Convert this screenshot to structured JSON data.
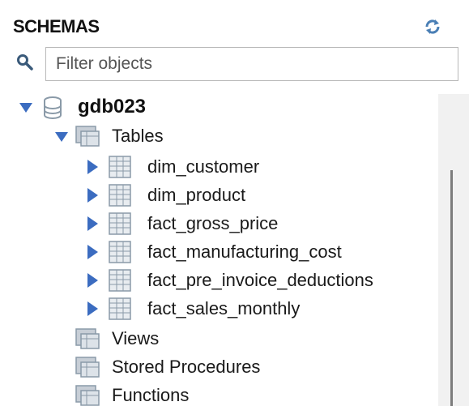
{
  "header": {
    "title": "SCHEMAS"
  },
  "icons": {
    "refresh": "refresh-icon",
    "search": "search-icon"
  },
  "filter": {
    "placeholder": "Filter objects",
    "value": ""
  },
  "tree": {
    "schema": {
      "name": "gdb023",
      "expanded": true
    },
    "tables_folder": {
      "label": "Tables",
      "expanded": true
    },
    "tables": [
      "dim_customer",
      "dim_product",
      "fact_gross_price",
      "fact_manufacturing_cost",
      "fact_pre_invoice_deductions",
      "fact_sales_monthly"
    ],
    "folders": [
      "Views",
      "Stored Procedures",
      "Functions"
    ]
  },
  "colors": {
    "arrow": "#3b6cc0",
    "icon_gray": "#8a9aa8"
  }
}
